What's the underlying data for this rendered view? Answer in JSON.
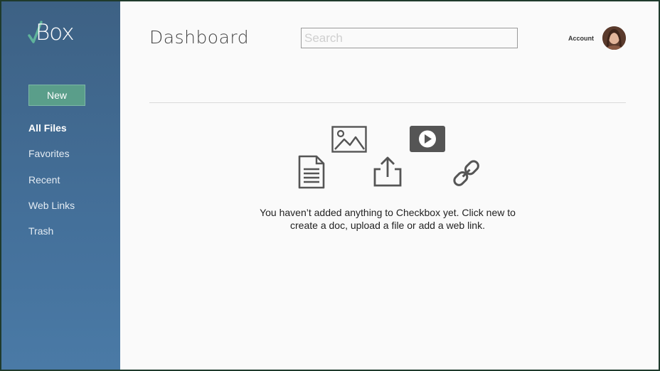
{
  "app": {
    "logo_text": "Box"
  },
  "sidebar": {
    "new_label": "New",
    "items": [
      {
        "label": "All Files",
        "active": true
      },
      {
        "label": "Favorites",
        "active": false
      },
      {
        "label": "Recent",
        "active": false
      },
      {
        "label": "Web Links",
        "active": false
      },
      {
        "label": "Trash",
        "active": false
      }
    ]
  },
  "header": {
    "title": "Dashboard",
    "search_placeholder": "Search",
    "account_label": "Account"
  },
  "empty_state": {
    "icons": [
      "document-icon",
      "image-icon",
      "upload-icon",
      "video-icon",
      "link-icon"
    ],
    "line1": "You haven’t added anything to Checkbox yet. Click new to",
    "line2": "create a doc, upload a file or add a web link."
  },
  "colors": {
    "sidebar_top": "#3d6184",
    "sidebar_bottom": "#4a7aa6",
    "accent_green": "#5a9e8a",
    "icon_gray": "#555555"
  }
}
